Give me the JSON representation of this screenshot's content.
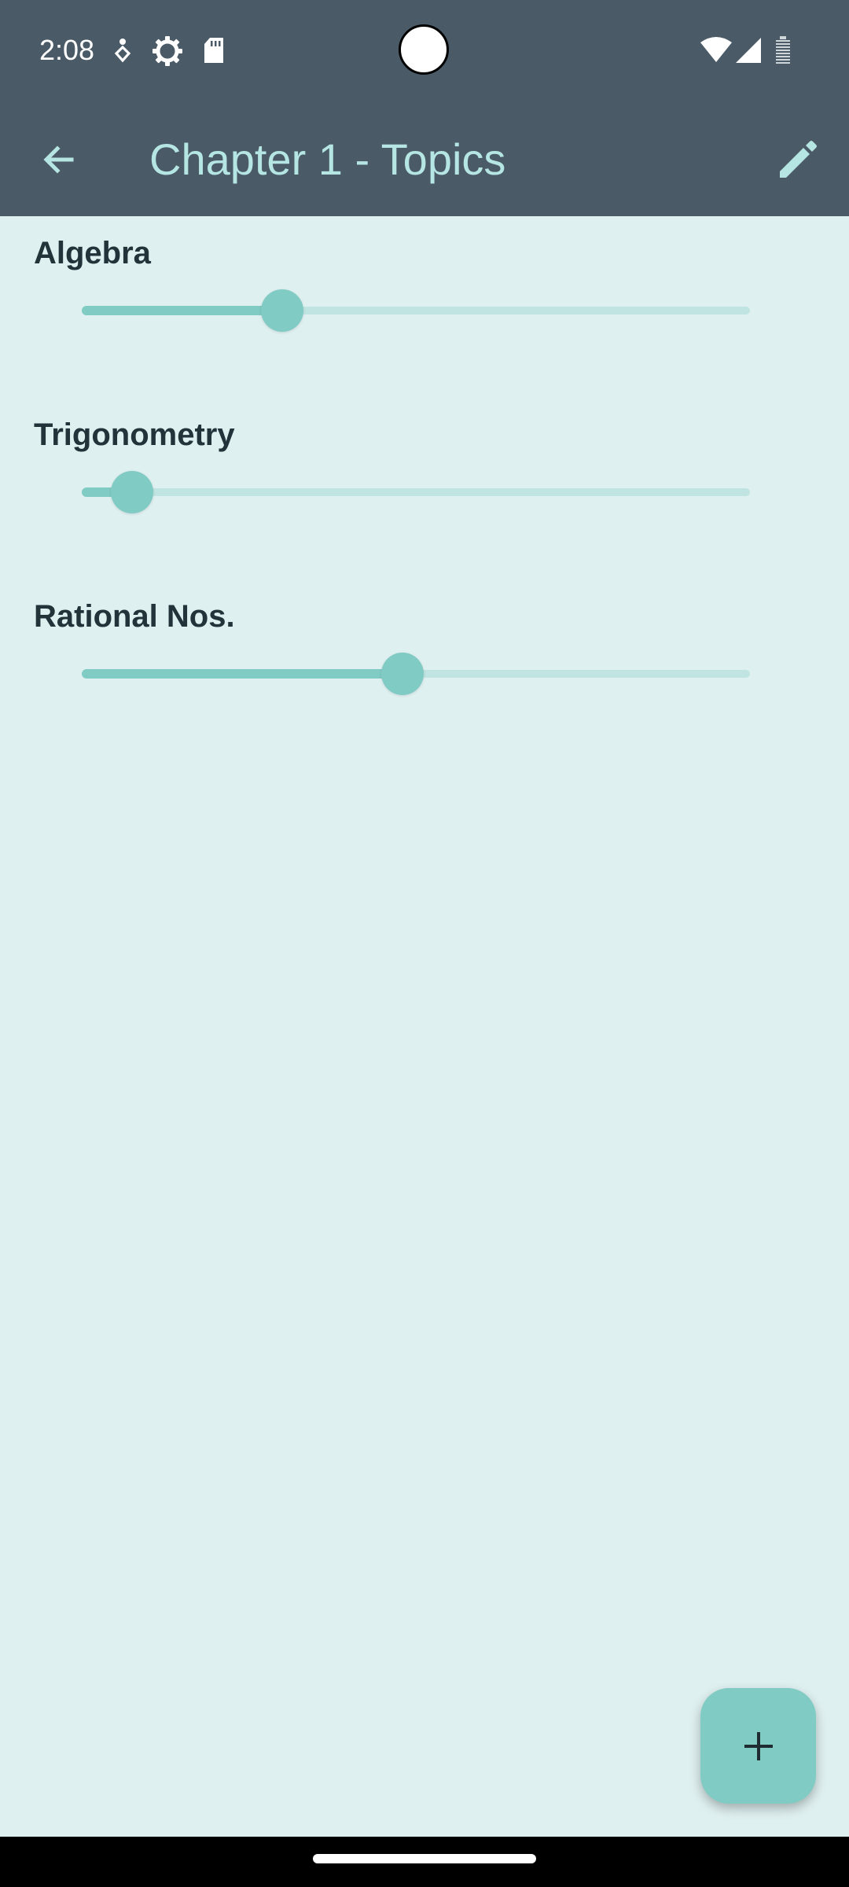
{
  "status_bar": {
    "time": "2:08",
    "left_icons": [
      "accessibility-icon",
      "settings-gear-icon",
      "sd-card-icon"
    ],
    "right_icons": [
      "wifi-icon",
      "cell-signal-icon",
      "battery-icon"
    ]
  },
  "app_bar": {
    "back_icon": "arrow-back-icon",
    "title": "Chapter 1 - Topics",
    "edit_icon": "pencil-edit-icon",
    "title_color": "#b5e6e3",
    "background_color": "#4a5a67"
  },
  "topics": [
    {
      "label": "Algebra",
      "progress": 0.3
    },
    {
      "label": "Trigonometry",
      "progress": 0.075
    },
    {
      "label": "Rational Nos.",
      "progress": 0.48
    }
  ],
  "fab": {
    "icon": "plus-icon"
  },
  "colors": {
    "accent": "#80cbc4",
    "track": "#c0e4e1",
    "background": "#dff0f0",
    "label": "#22333a"
  }
}
